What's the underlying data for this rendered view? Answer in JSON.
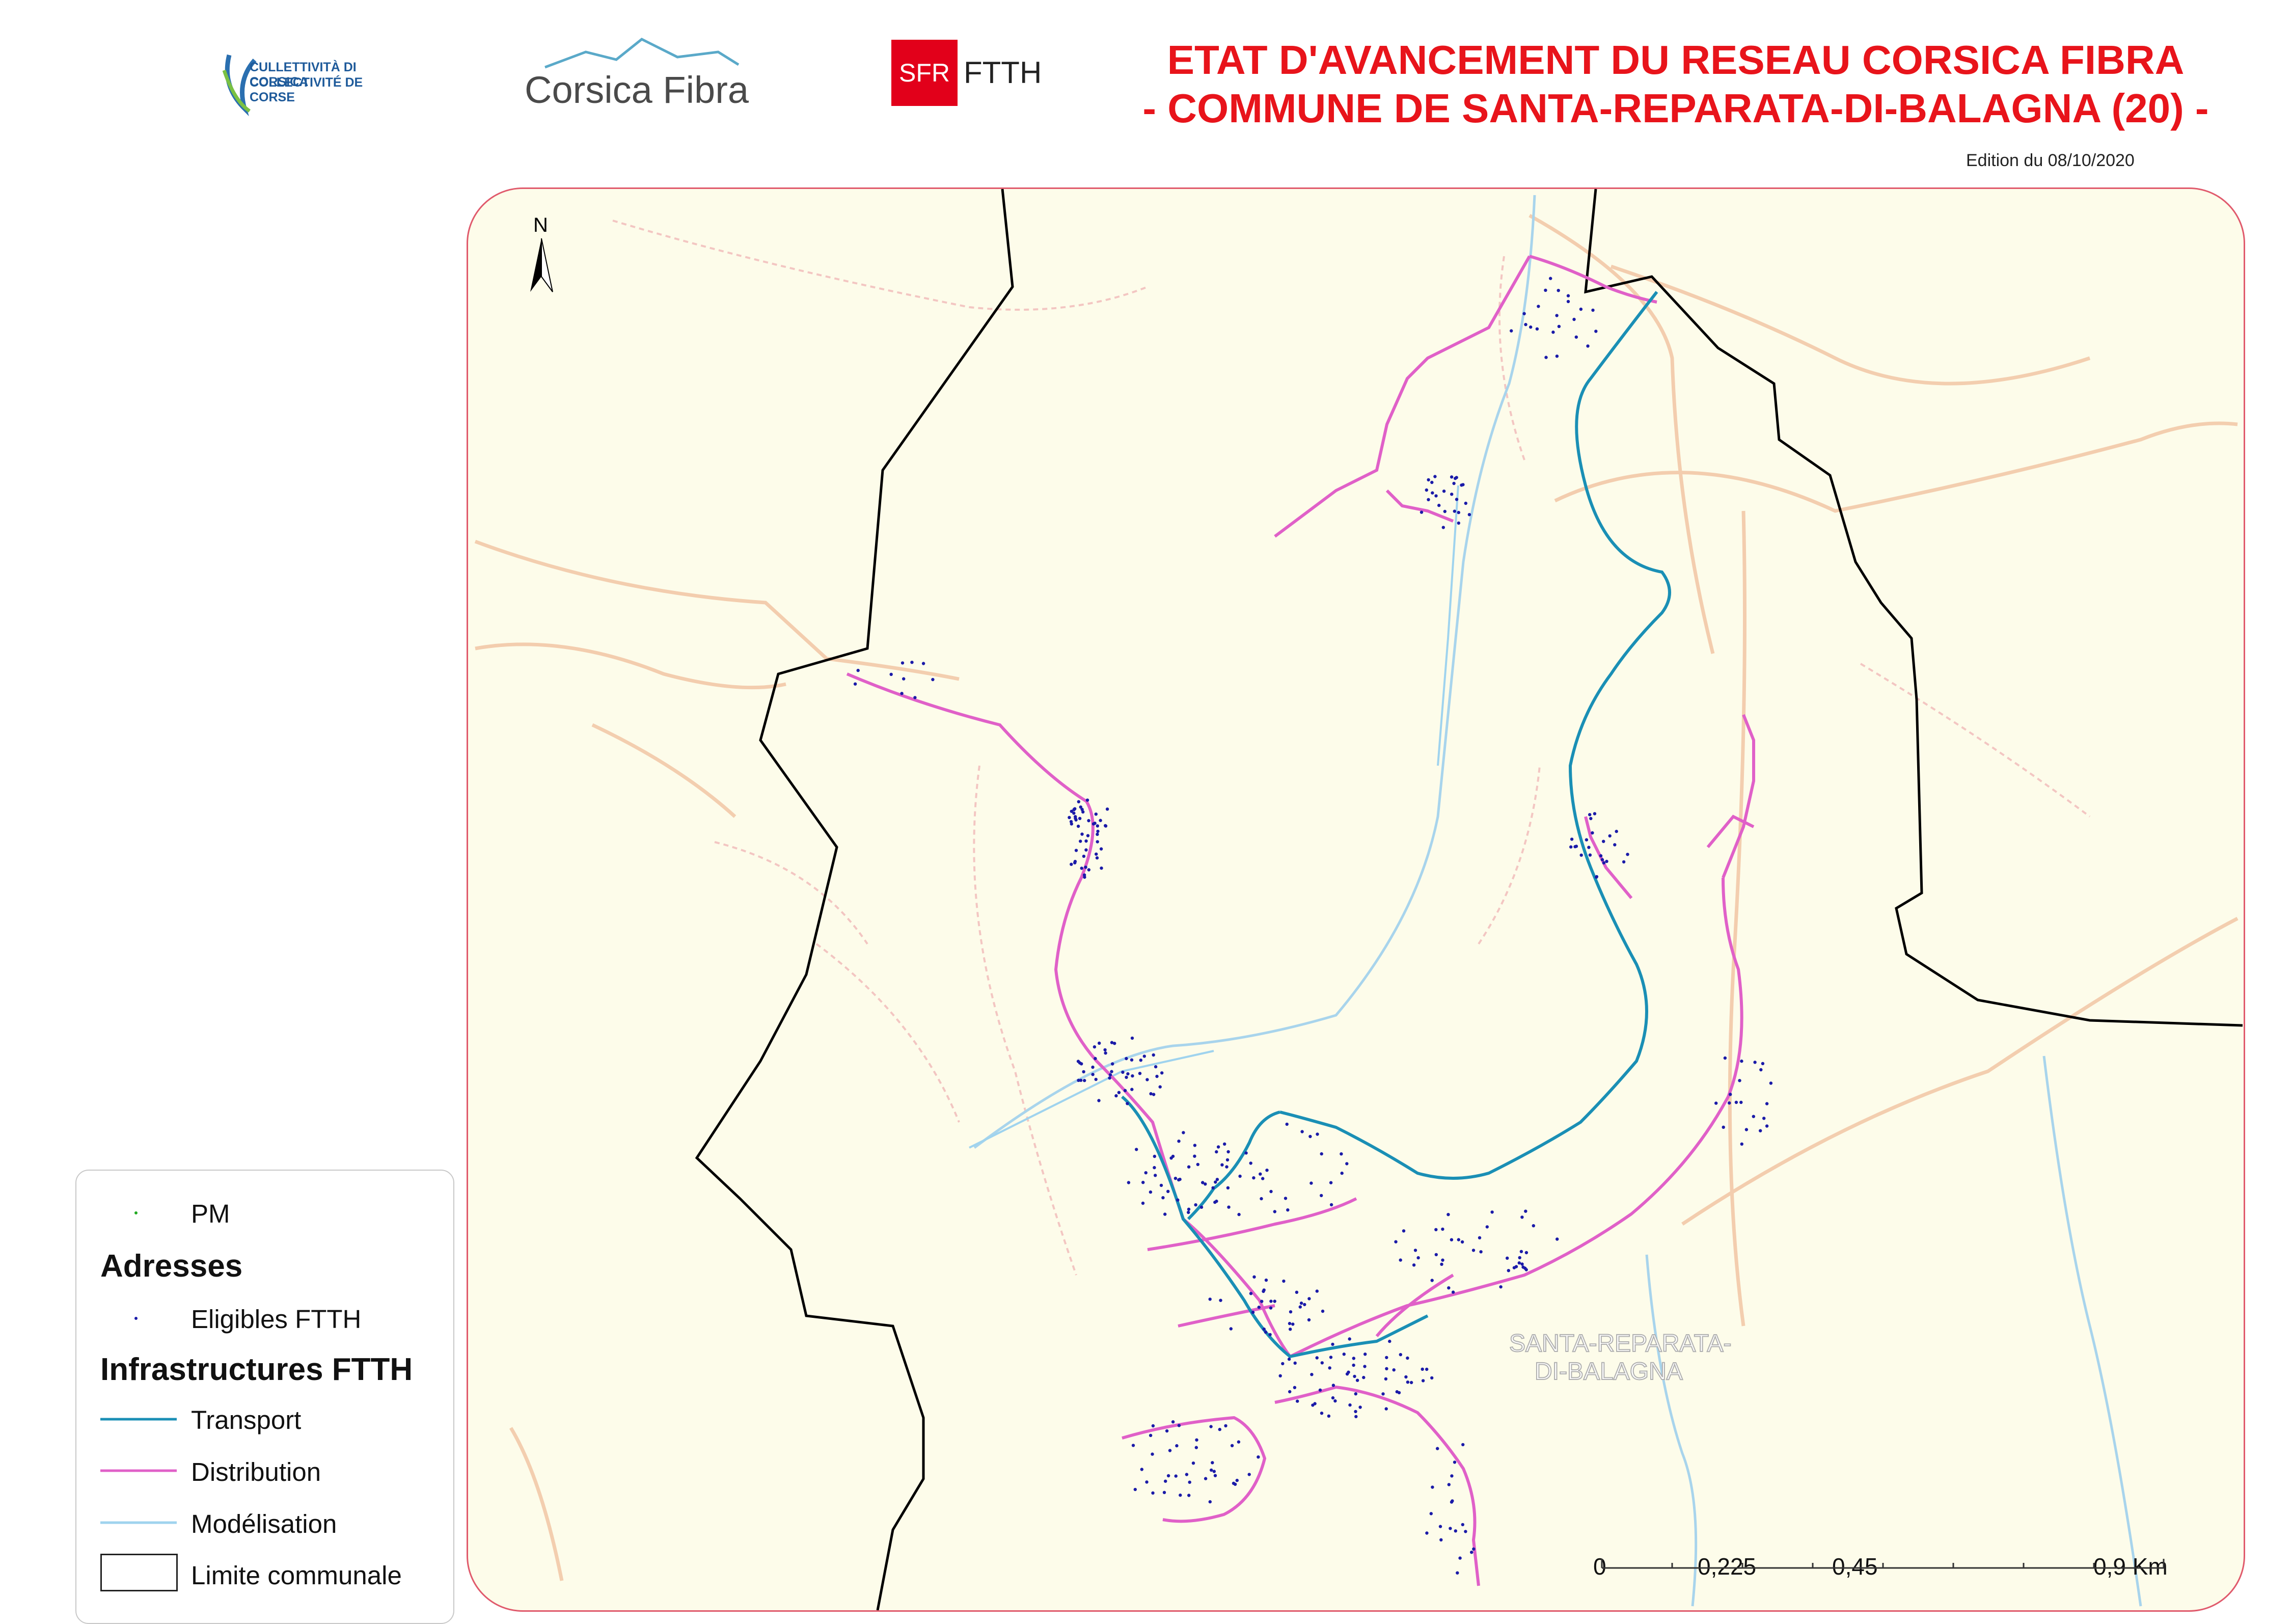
{
  "header": {
    "title_line1": "ETAT D'AVANCEMENT DU RESEAU CORSICA FIBRA",
    "title_line2": "- COMMUNE DE SANTA-REPARATA-DI-BALAGNA (20) -",
    "edition": "Edition du 08/10/2020"
  },
  "logos": {
    "collectivite_line1": "CULLETTIVITÀ DI CORSICA",
    "collectivite_line2": "COLLECTIVITÉ DE CORSE",
    "corsica_fibra": "Corsica Fibra",
    "sfr_badge": "SFR",
    "ftth": "FTTH"
  },
  "map": {
    "north_label": "N",
    "place_label_line1": "SANTA-REPARATA-",
    "place_label_line2": "DI-BALAGNA",
    "colors": {
      "background": "#fdfcea",
      "transport": "#1a8fb5",
      "distribution": "#e060c8",
      "modelisation": "#9fd3ee",
      "limite": "#000000",
      "address_dots": "#1a1aa8",
      "pm": "#22aa22",
      "roads": "#f2c9a8"
    }
  },
  "legend": {
    "pm": "PM",
    "adresses_header": "Adresses",
    "eligibles": "Eligibles FTTH",
    "infra_header": "Infrastructures FTTH",
    "transport": "Transport",
    "distribution": "Distribution",
    "modelisation": "Modélisation",
    "limite": "Limite communale"
  },
  "scale": {
    "labels": [
      "0",
      "0,225",
      "0,45",
      "0,9 Km"
    ]
  }
}
